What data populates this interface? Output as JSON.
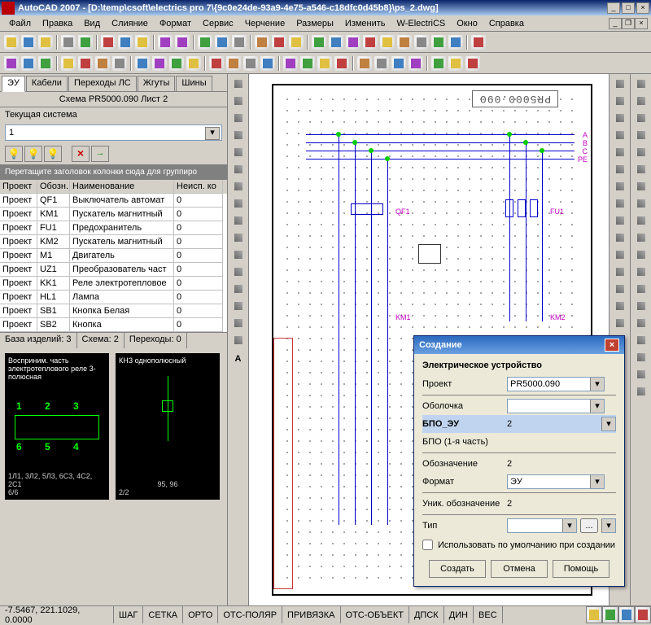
{
  "title": "AutoCAD 2007 - [D:\\temp\\csoft\\electrics pro 7\\{9c0e24de-93a9-4e75-a546-c18dfc0d45b8}\\ps_2.dwg]",
  "menu": [
    "Файл",
    "Правка",
    "Вид",
    "Слияние",
    "Формат",
    "Сервис",
    "Черчение",
    "Размеры",
    "Изменить",
    "W-ElectriCS",
    "Окно",
    "Справка"
  ],
  "tabs": [
    "ЭУ",
    "Кабели",
    "Переходы ЛС",
    "Жгуты",
    "Шины"
  ],
  "panel_title": "Схема PR5000.090 Лист 2",
  "system_label": "Текущая система",
  "system_value": "1",
  "group_hint": "Перетащите заголовок колонки сюда для группиро",
  "grid_cols": [
    "Проект",
    "Обозн.",
    "Наименование",
    "Неисп. ко"
  ],
  "grid_rows": [
    {
      "p": "Проект",
      "o": "QF1",
      "n": "Выключатель автомат",
      "u": "0"
    },
    {
      "p": "Проект",
      "o": "KM1",
      "n": "Пускатель магнитный",
      "u": "0"
    },
    {
      "p": "Проект",
      "o": "FU1",
      "n": "Предохранитель",
      "u": "0"
    },
    {
      "p": "Проект",
      "o": "KM2",
      "n": "Пускатель магнитный",
      "u": "0"
    },
    {
      "p": "Проект",
      "o": "M1",
      "n": "Двигатель",
      "u": "0"
    },
    {
      "p": "Проект",
      "o": "UZ1",
      "n": "Преобразователь част",
      "u": "0"
    },
    {
      "p": "Проект",
      "o": "KK1",
      "n": "Реле электротепловое",
      "u": "0"
    },
    {
      "p": "Проект",
      "o": "HL1",
      "n": "Лампа",
      "u": "0"
    },
    {
      "p": "Проект",
      "o": "SB1",
      "n": "Кнопка Белая",
      "u": "0"
    },
    {
      "p": "Проект",
      "o": "SB2",
      "n": "Кнопка",
      "u": "0"
    }
  ],
  "status_tabs": {
    "a": "База изделий: 3",
    "b": "Схема: 2",
    "c": "Переходы: 0"
  },
  "preview1": {
    "title": "Восприним. часть электротеплового реле 3-полюсная",
    "nums": [
      "1",
      "2",
      "3",
      "6",
      "5",
      "4"
    ],
    "foot1": "1Л1, 3Л2, 5Л3, 6С3, 4С2, 2С1",
    "foot2": "6/6"
  },
  "preview2": {
    "title": "КНЗ однополюсный",
    "foot1": "95, 96",
    "foot2": "2/2"
  },
  "drawing_title": "PR5000.090",
  "bus_labels": [
    "A",
    "B",
    "C",
    "PE"
  ],
  "comp_labels": {
    "qf1": "QF1",
    "fu1": "FU1",
    "km1": "KM1",
    "km2": "KM2"
  },
  "dialog": {
    "title": "Создание",
    "heading": "Электрическое устройство",
    "rows": {
      "project_l": "Проект",
      "project_v": "PR5000.090",
      "shell_l": "Оболочка",
      "shell_v": "",
      "bpo_l": "БПО_ЭУ",
      "bpo_v": "2",
      "bpo_note": "БПО (1-я часть)",
      "desig_l": "Обозначение",
      "desig_v": "2",
      "format_l": "Формат",
      "format_v": "ЭУ",
      "uniq_l": "Уник. обозначение",
      "uniq_v": "2",
      "type_l": "Тип",
      "type_v": ""
    },
    "checkbox": "Использовать по умолчанию при создании",
    "btns": {
      "create": "Создать",
      "cancel": "Отмена",
      "help": "Помощь"
    }
  },
  "statusbar": {
    "coords": "-7.5467, 221.1029, 0.0000",
    "modes": [
      "ШАГ",
      "СЕТКА",
      "ОРТО",
      "ОТС-ПОЛЯР",
      "ПРИВЯЗКА",
      "ОТС-ОБЪЕКТ",
      "ДПСК",
      "ДИН",
      "ВЕС"
    ]
  }
}
